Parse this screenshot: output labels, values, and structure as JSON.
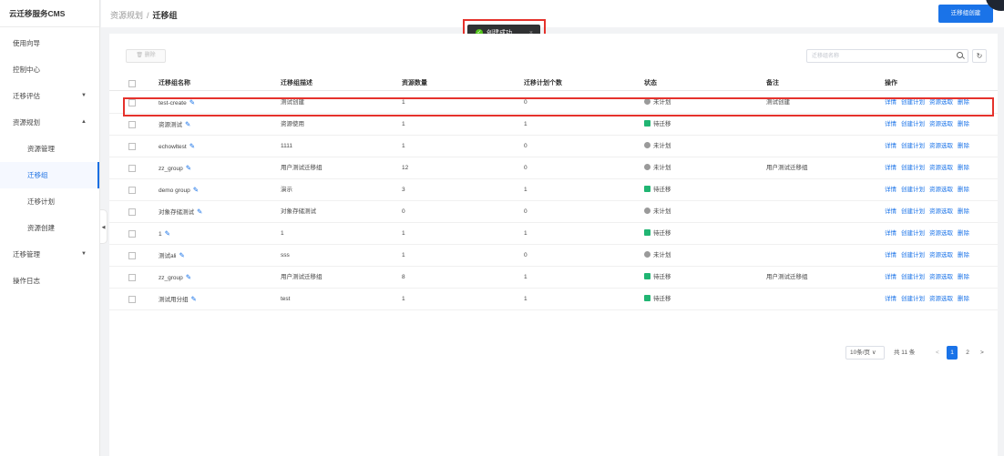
{
  "app": {
    "title": "云迁移服务CMS"
  },
  "sidebar": {
    "items": [
      {
        "label": "使用向导"
      },
      {
        "label": "控制中心"
      },
      {
        "label": "迁移评估",
        "chevron": "▼"
      },
      {
        "label": "资源规划",
        "chevron": "▲"
      },
      {
        "label": "资源管理"
      },
      {
        "label": "迁移组"
      },
      {
        "label": "迁移计划"
      },
      {
        "label": "资源创建"
      },
      {
        "label": "迁移管理",
        "chevron": "▼"
      },
      {
        "label": "操作日志"
      }
    ]
  },
  "header": {
    "breadcrumb_parent": "资源规划",
    "breadcrumb_sep": "/",
    "breadcrumb_current": "迁移组",
    "create_label": "迁移组创建"
  },
  "toast": {
    "message": "创建成功",
    "close": "×"
  },
  "toolbar": {
    "delete_label": "🗑 删除",
    "search_placeholder": "迁移组名称",
    "refresh_icon": "↻"
  },
  "table": {
    "headers": {
      "name": "迁移组名称",
      "desc": "迁移组描述",
      "count": "资源数量",
      "plans": "迁移计划个数",
      "status": "状态",
      "remark": "备注",
      "ops": "操作"
    },
    "ops": {
      "detail": "详情",
      "create_plan": "创建计划",
      "collect": "资源选取",
      "delete": "删除"
    },
    "rows": [
      {
        "name": "test-create",
        "desc": "测试创建",
        "count": "1",
        "plans": "0",
        "status": "未计划",
        "status_type": "plan",
        "remark": "测试创建"
      },
      {
        "name": "资源测试",
        "desc": "资源使用",
        "count": "1",
        "plans": "1",
        "status": "待迁移",
        "status_type": "wait",
        "remark": ""
      },
      {
        "name": "echowltest",
        "desc": "1111",
        "count": "1",
        "plans": "0",
        "status": "未计划",
        "status_type": "plan",
        "remark": ""
      },
      {
        "name": "zz_group",
        "desc": "用户测试迁移组",
        "count": "12",
        "plans": "0",
        "status": "未计划",
        "status_type": "plan",
        "remark": "用户测试迁移组"
      },
      {
        "name": "demo group",
        "desc": "演示",
        "count": "3",
        "plans": "1",
        "status": "待迁移",
        "status_type": "wait",
        "remark": ""
      },
      {
        "name": "对象存储测试",
        "desc": "对象存储测试",
        "count": "0",
        "plans": "0",
        "status": "未计划",
        "status_type": "plan",
        "remark": ""
      },
      {
        "name": "1",
        "desc": "1",
        "count": "1",
        "plans": "1",
        "status": "待迁移",
        "status_type": "wait",
        "remark": ""
      },
      {
        "name": "测试ali",
        "desc": "sss",
        "count": "1",
        "plans": "0",
        "status": "未计划",
        "status_type": "plan",
        "remark": ""
      },
      {
        "name": "zz_group",
        "desc": "用户测试迁移组",
        "count": "8",
        "plans": "1",
        "status": "待迁移",
        "status_type": "wait",
        "remark": "用户测试迁移组"
      },
      {
        "name": "测试用分组",
        "desc": "test",
        "count": "1",
        "plans": "1",
        "status": "待迁移",
        "status_type": "wait",
        "remark": ""
      }
    ]
  },
  "pagination": {
    "page_size": "10条/页 ∨",
    "total": "共 11 条",
    "prev": "<",
    "pages": [
      "1",
      "2"
    ],
    "next": ">"
  },
  "colors": {
    "accent": "#1a73e8",
    "highlight": "#e5322c",
    "status_wait": "#21b573",
    "status_plan": "#9a9a9a"
  }
}
